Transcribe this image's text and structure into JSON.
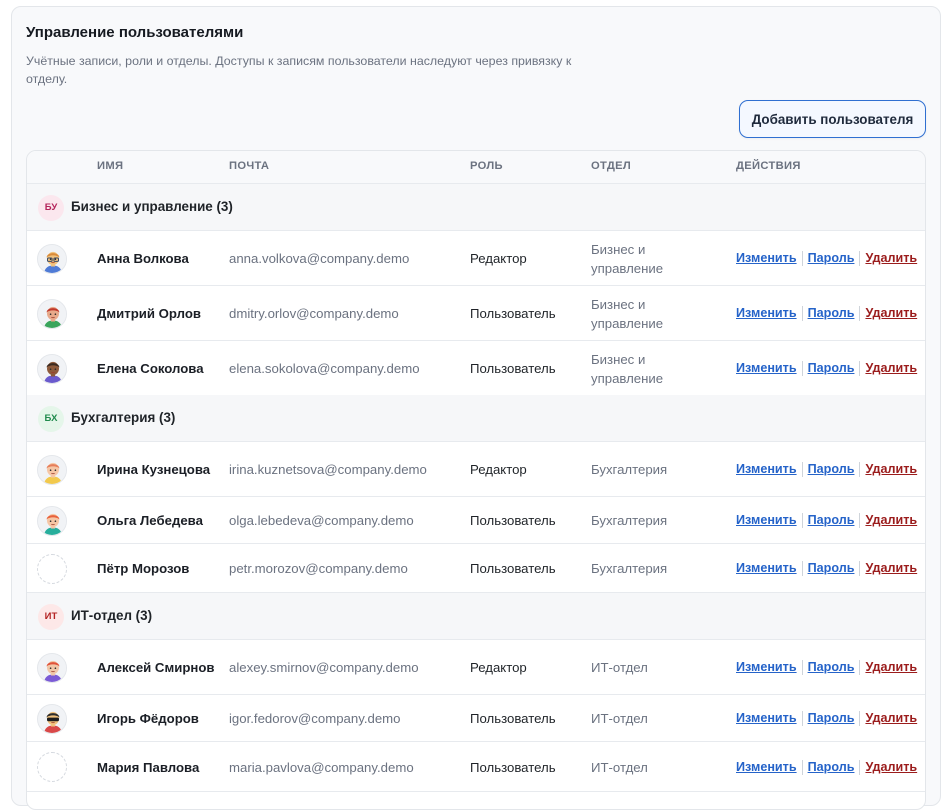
{
  "header": {
    "title": "Управление пользователями",
    "subtitle": "Учётные записи, роли и отделы. Доступы к записям пользователи наследуют через привязку к отделу.",
    "add_button": "Добавить пользователя"
  },
  "table": {
    "columns": [
      "ИМЯ",
      "ПОЧТА",
      "РОЛЬ",
      "ОТДЕЛ",
      "ДЕЙСТВИЯ"
    ],
    "actions": {
      "edit": "Изменить",
      "password": "Пароль",
      "delete": "Удалить"
    },
    "groups": [
      {
        "badge": "БУ",
        "label": "Бизнес и управление (3)",
        "badge_bg": "#fbe7ee",
        "badge_fg": "#b4235a",
        "users": [
          {
            "name": "Анна Волкова",
            "email": "anna.volkova@company.demo",
            "role": "Редактор",
            "dept": "Бизнес и управление",
            "avatar": "avatar-anna",
            "skin": "#f1c27d",
            "hair": "#d98b3a",
            "shirt": "#4f7bd6",
            "glasses": true
          },
          {
            "name": "Дмитрий Орлов",
            "email": "dmitry.orlov@company.demo",
            "role": "Пользователь",
            "dept": "Бизнес и управление",
            "avatar": "avatar-dmitry",
            "skin": "#e8a98a",
            "hair": "#c0392b",
            "shirt": "#3aa55c"
          },
          {
            "name": "Елена Соколова",
            "email": "elena.sokolova@company.demo",
            "role": "Пользователь",
            "dept": "Бизнес и управление",
            "avatar": "avatar-elena",
            "skin": "#8d5a3b",
            "hair": "#3b2a20",
            "shirt": "#6a5acd"
          }
        ]
      },
      {
        "badge": "БХ",
        "label": "Бухгалтерия (3)",
        "badge_bg": "#e5f6ea",
        "badge_fg": "#1f8a4c",
        "users": [
          {
            "name": "Ирина Кузнецова",
            "email": "irina.kuznetsova@company.demo",
            "role": "Редактор",
            "dept": "Бухгалтерия",
            "avatar": "avatar-irina",
            "skin": "#f6c6a5",
            "hair": "#e67e5a",
            "shirt": "#f2c94c"
          },
          {
            "name": "Ольга Лебедева",
            "email": "olga.lebedeva@company.demo",
            "role": "Пользователь",
            "dept": "Бухгалтерия",
            "avatar": "avatar-olga",
            "skin": "#f6c6a5",
            "hair": "#e8623c",
            "shirt": "#27ae9c"
          },
          {
            "name": "Пётр Морозов",
            "email": "petr.morozov@company.demo",
            "role": "Пользователь",
            "dept": "Бухгалтерия",
            "avatar": "avatar-empty"
          }
        ]
      },
      {
        "badge": "ИТ",
        "label": "ИТ-отдел (3)",
        "badge_bg": "#fde8e8",
        "badge_fg": "#b42323",
        "users": [
          {
            "name": "Алексей Смирнов",
            "email": "alexey.smirnov@company.demo",
            "role": "Редактор",
            "dept": "ИТ-отдел",
            "avatar": "avatar-alexey",
            "skin": "#f1c7a8",
            "hair": "#e0533a",
            "shirt": "#7b5bd6"
          },
          {
            "name": "Игорь Фёдоров",
            "email": "igor.fedorov@company.demo",
            "role": "Пользователь",
            "dept": "ИТ-отдел",
            "avatar": "avatar-igor",
            "skin": "#f1c27d",
            "hair": "#2d2d2d",
            "shirt": "#d94848",
            "sunglasses": true
          },
          {
            "name": "Мария Павлова",
            "email": "maria.pavlova@company.demo",
            "role": "Пользователь",
            "dept": "ИТ-отдел",
            "avatar": "avatar-empty"
          }
        ]
      }
    ]
  }
}
